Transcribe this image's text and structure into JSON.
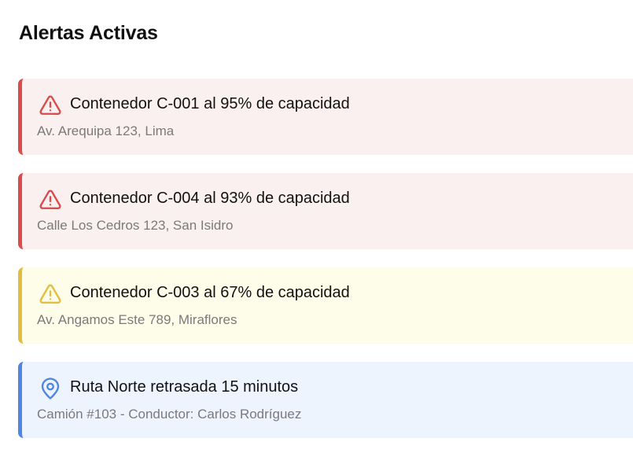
{
  "title": "Alertas Activas",
  "colors": {
    "danger": "#dc4b4b",
    "warning": "#e5bd3e",
    "info": "#4f86e4"
  },
  "alerts": [
    {
      "type": "danger",
      "icon": "warning-triangle-icon",
      "headline": "Contenedor C-001 al 95% de capacidad",
      "detail": "Av. Arequipa 123, Lima"
    },
    {
      "type": "danger",
      "icon": "warning-triangle-icon",
      "headline": "Contenedor C-004 al 93% de capacidad",
      "detail": "Calle Los Cedros 123, San Isidro"
    },
    {
      "type": "warning",
      "icon": "warning-triangle-icon",
      "headline": "Contenedor C-003 al 67% de capacidad",
      "detail": "Av. Angamos Este 789, Miraflores"
    },
    {
      "type": "info",
      "icon": "map-pin-icon",
      "headline": "Ruta Norte retrasada 15 minutos",
      "detail": "Camión #103 - Conductor: Carlos Rodríguez"
    }
  ]
}
